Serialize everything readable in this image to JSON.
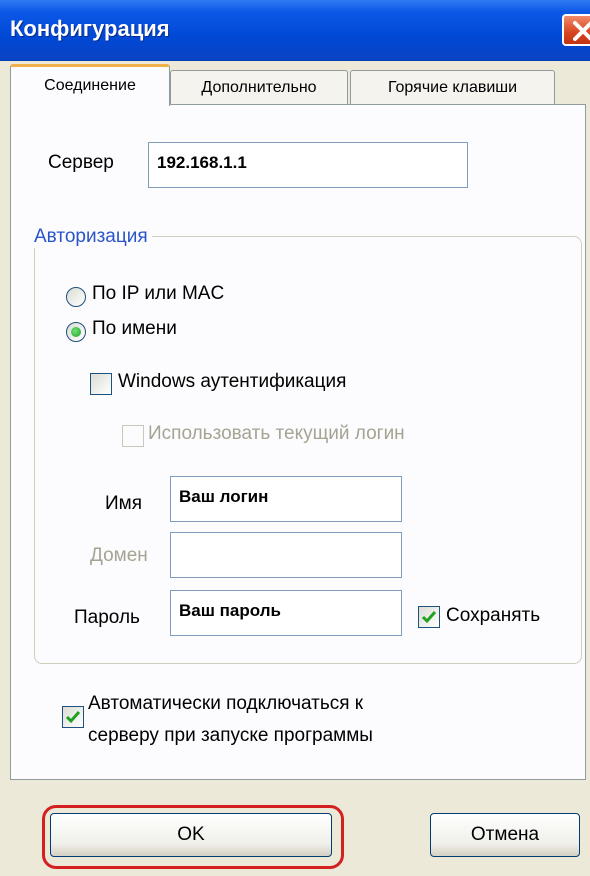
{
  "window": {
    "title": "Конфигурация"
  },
  "tabs": [
    {
      "label": "Соединение",
      "active": true
    },
    {
      "label": "Дополнительно",
      "active": false
    },
    {
      "label": "Горячие клавиши",
      "active": false
    }
  ],
  "server": {
    "label": "Сервер",
    "value": "192.168.1.1"
  },
  "authorization": {
    "group_title": "Авторизация",
    "radio_ip_mac": {
      "label": "По IP или MAC",
      "selected": false
    },
    "radio_name": {
      "label": "По имени",
      "selected": true
    },
    "windows_auth": {
      "label": "Windows аутентификация",
      "checked": false
    },
    "use_current_login": {
      "label": "Использовать текущий логин",
      "checked": false,
      "disabled": true
    },
    "name": {
      "label": "Имя",
      "value": "Ваш логин"
    },
    "domain": {
      "label": "Домен",
      "value": "",
      "disabled": true
    },
    "password": {
      "label": "Пароль",
      "value": "Ваш пароль"
    },
    "save": {
      "label": "Сохранять",
      "checked": true
    }
  },
  "auto_connect": {
    "line1": "Автоматически подключаться к",
    "line2": "серверу при запуске программы",
    "checked": true
  },
  "buttons": {
    "ok": "OK",
    "cancel": "Отмена"
  },
  "colors": {
    "titlebar": "#0049d6",
    "highlight": "#d42020",
    "check": "#21a121"
  }
}
